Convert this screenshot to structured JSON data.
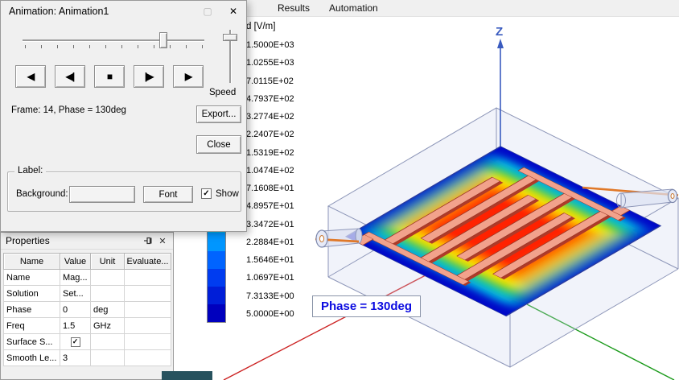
{
  "menu": {
    "items": [
      "Results",
      "Automation"
    ]
  },
  "icons": {
    "close": "✕",
    "maximize": "▢",
    "check": "✓"
  },
  "animation_dialog": {
    "title": "Animation: Animation1",
    "frame_text": "Frame: 14, Phase = 130deg",
    "speed_label": "Speed",
    "export_label": "Export...",
    "close_label": "Close",
    "playback_buttons": [
      {
        "name": "play-reverse",
        "glyph": "◀"
      },
      {
        "name": "step-back",
        "glyph": "◀|"
      },
      {
        "name": "stop",
        "glyph": "■"
      },
      {
        "name": "step-forward",
        "glyph": "|▶"
      },
      {
        "name": "play-forward",
        "glyph": "▶"
      }
    ],
    "label_group": {
      "title": "Label:",
      "background_label": "Background:",
      "font_label": "Font",
      "show_label": "Show",
      "show_checked": true
    }
  },
  "properties_panel": {
    "title": "Properties",
    "columns": [
      "Name",
      "Value",
      "Unit",
      "Evaluate..."
    ],
    "rows": [
      {
        "name": "Name",
        "value": "Mag...",
        "unit": "",
        "evaluate": "",
        "checkbox": false,
        "checked": false
      },
      {
        "name": "Solution",
        "value": "Set...",
        "unit": "",
        "evaluate": "",
        "checkbox": false,
        "checked": false
      },
      {
        "name": "Phase",
        "value": "0",
        "unit": "deg",
        "evaluate": "",
        "checkbox": false,
        "checked": false
      },
      {
        "name": "Freq",
        "value": "1.5",
        "unit": "GHz",
        "evaluate": "",
        "checkbox": false,
        "checked": false
      },
      {
        "name": "Surface S...",
        "value": "",
        "unit": "",
        "evaluate": "",
        "checkbox": true,
        "checked": true
      },
      {
        "name": "Smooth Le...",
        "value": "3",
        "unit": "",
        "evaluate": "",
        "checkbox": false,
        "checked": false
      }
    ]
  },
  "legend": {
    "header": "d [V/m]",
    "entries": [
      {
        "value": "1.5000E+03",
        "color": "#ff0000"
      },
      {
        "value": "1.0255E+03",
        "color": "#ff5000"
      },
      {
        "value": "7.0115E+02",
        "color": "#ff8c00"
      },
      {
        "value": "4.7937E+02",
        "color": "#ffc800"
      },
      {
        "value": "3.2774E+02",
        "color": "#fff000"
      },
      {
        "value": "2.2407E+02",
        "color": "#b4f000"
      },
      {
        "value": "1.5319E+02",
        "color": "#64e100"
      },
      {
        "value": "1.0474E+02",
        "color": "#00d21e"
      },
      {
        "value": "7.1608E+01",
        "color": "#00d278"
      },
      {
        "value": "4.8957E+01",
        "color": "#00d2c8"
      },
      {
        "value": "3.3472E+01",
        "color": "#00b4e6"
      },
      {
        "value": "2.2884E+01",
        "color": "#0096ff"
      },
      {
        "value": "1.5646E+01",
        "color": "#0064ff"
      },
      {
        "value": "1.0697E+01",
        "color": "#003cf0"
      },
      {
        "value": "7.3133E+00",
        "color": "#001ed8"
      },
      {
        "value": "5.0000E+00",
        "color": "#0000be"
      }
    ]
  },
  "viewport": {
    "phase_label": "Phase = 130deg",
    "z_axis_label": "Z",
    "axis_colors": {
      "x": "#cc2222",
      "y": "#1a9a1a",
      "z": "#3a5bbf"
    },
    "field_colors": [
      "#0008c8",
      "#00b4e8",
      "#22cc22",
      "#ffee00",
      "#ff8800",
      "#ff2200"
    ]
  }
}
